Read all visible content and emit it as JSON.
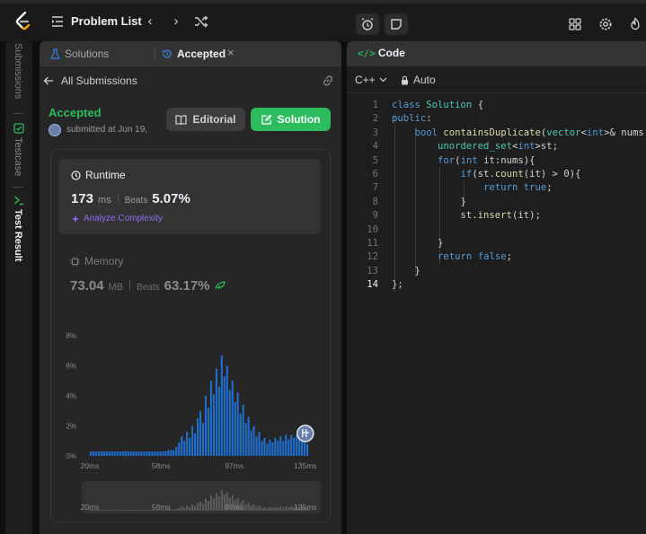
{
  "topbar": {
    "title": "Problem List",
    "prev_icon": "chevron-left-icon",
    "next_icon": "chevron-right-icon",
    "shuffle_icon": "shuffle-icon"
  },
  "vtabs": {
    "items": [
      {
        "label": "Submissions"
      },
      {
        "label": "Testcase"
      },
      {
        "label": "Test Result"
      }
    ]
  },
  "left_panel": {
    "tab_solutions": "Solutions",
    "tab_accepted": "Accepted",
    "back_label": "All Submissions",
    "status": "Accepted",
    "submitted": "submitted at Jun 19,",
    "editorial_label": "Editorial",
    "solution_label": "Solution",
    "runtime": {
      "title": "Runtime",
      "value": "173",
      "unit": "ms",
      "beats_label": "Beats",
      "beats_value": "5.07%",
      "analyze": "Analyze Complexity"
    },
    "memory": {
      "title": "Memory",
      "value": "73.04",
      "unit": "MB",
      "beats_label": "Beats",
      "beats_value": "63.17%"
    },
    "colors": {
      "accepted_green": "#2cbb5d",
      "bar_blue": "#1f6fd1",
      "analyze_purple": "#8e6ef5"
    }
  },
  "chart_data": {
    "type": "bar",
    "title": "",
    "xlabel": "",
    "ylabel": "",
    "y_ticks": [
      "8%",
      "6%",
      "4%",
      "2%",
      "0%"
    ],
    "x_ticks": [
      "20ms",
      "58ms",
      "97ms",
      "135ms"
    ],
    "ylim": [
      0,
      8
    ],
    "x_range_ms": [
      20,
      137
    ],
    "series": [
      {
        "values": [
          0.3,
          0.3,
          0.3,
          0.3,
          0.3,
          0.3,
          0.3,
          0.3,
          0.3,
          0.3,
          0.3,
          0.3,
          0.3,
          0.3,
          0.3,
          0.3,
          0.3,
          0.3,
          0.3,
          0.3,
          0.3,
          0.3,
          0.3,
          0.3,
          0.3,
          0.3,
          0.3,
          0.3,
          0.3,
          0.4,
          0.4,
          0.4,
          0.6,
          0.9,
          1.3,
          1.0,
          1.6,
          1.2,
          2.0,
          1.5,
          2.5,
          3.0,
          2.2,
          4.0,
          3.2,
          5.0,
          4.1,
          5.8,
          4.6,
          6.7,
          5.3,
          6.0,
          4.4,
          5.0,
          3.6,
          4.2,
          2.8,
          3.4,
          2.2,
          2.6,
          1.7,
          2.0,
          1.3,
          1.6,
          1.0,
          1.2,
          0.8,
          1.1,
          0.9,
          1.2,
          1.0,
          1.3,
          1.0,
          1.4,
          1.1,
          1.4,
          1.2,
          1.4,
          1.1,
          1.2,
          1.0,
          0.8
        ]
      }
    ],
    "marker_at_ms": 135
  },
  "right_panel": {
    "tab": "Code",
    "language": "C++",
    "auto": "Auto",
    "code_lines": [
      {
        "n": "1",
        "t": "class Solution {"
      },
      {
        "n": "2",
        "t": "public:"
      },
      {
        "n": "3",
        "t": "    bool containsDuplicate(vector<int>& nums"
      },
      {
        "n": "4",
        "t": "        unordered_set<int>st;"
      },
      {
        "n": "5",
        "t": "        for(int it:nums){"
      },
      {
        "n": "6",
        "t": "            if(st.count(it) > 0){"
      },
      {
        "n": "7",
        "t": "                return true;"
      },
      {
        "n": "8",
        "t": "            }"
      },
      {
        "n": "9",
        "t": "            st.insert(it);"
      },
      {
        "n": "10",
        "t": ""
      },
      {
        "n": "11",
        "t": "        }"
      },
      {
        "n": "12",
        "t": "        return false;"
      },
      {
        "n": "13",
        "t": "    }"
      },
      {
        "n": "14",
        "t": "};"
      }
    ]
  }
}
